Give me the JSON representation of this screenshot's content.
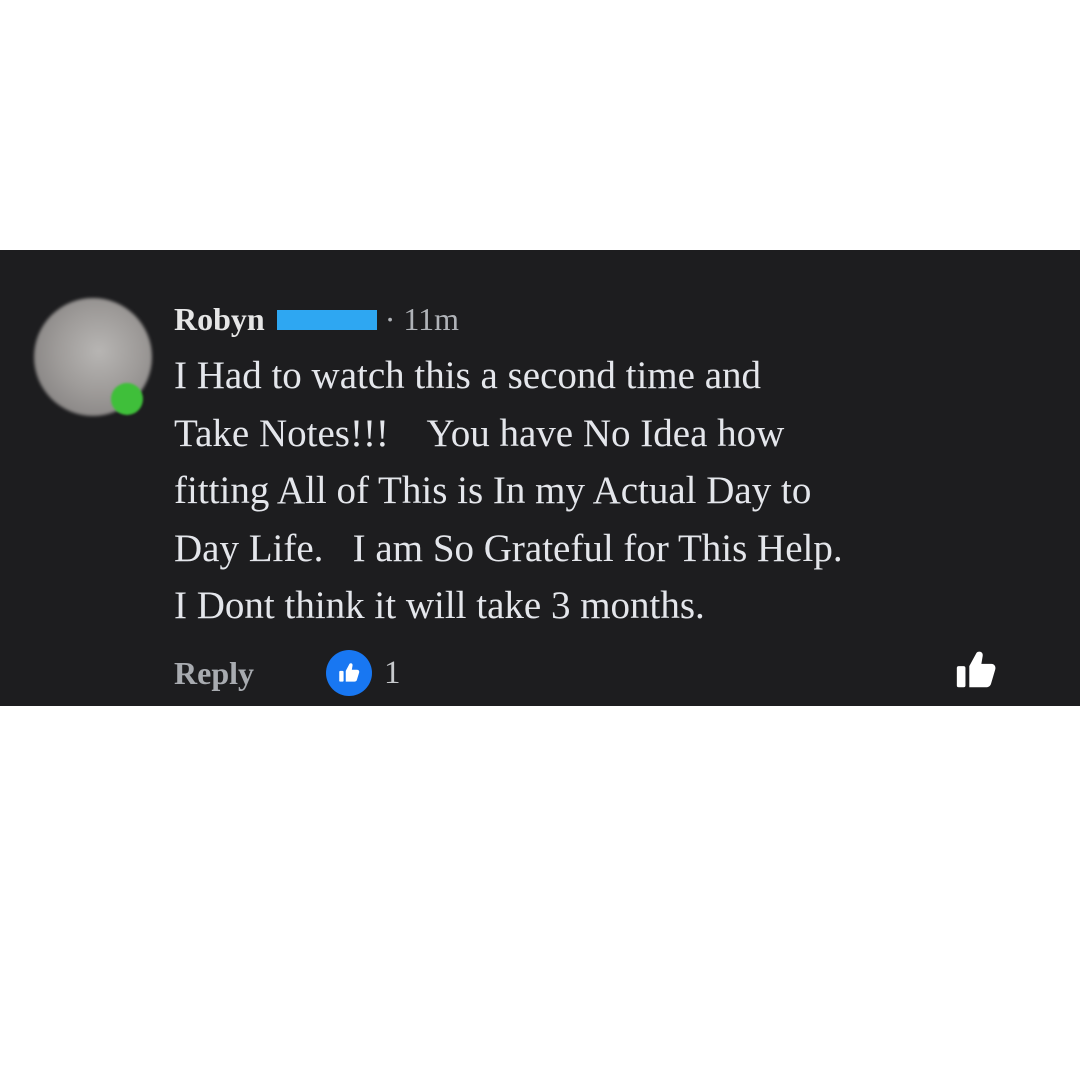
{
  "comment": {
    "author": "Robyn",
    "separator": "·",
    "time": "11m",
    "lines": [
      "I Had to watch this a second time and",
      "Take Notes!!!    You have No Idea how",
      "fitting All of This is In my Actual Day to",
      "Day Life.   I am So Grateful for This Help.",
      "I Dont think it will take 3 months."
    ],
    "actions": {
      "reply_label": "Reply",
      "reaction_count": "1",
      "reaction_icon": "thumbs-up-icon",
      "like_icon": "thumbs-up-outline-icon"
    }
  },
  "colors": {
    "card_background": "#1d1d1f",
    "reaction_blue": "#1877f2",
    "redaction_blue": "#2ea7f2",
    "online_green": "#3fbf3a"
  }
}
